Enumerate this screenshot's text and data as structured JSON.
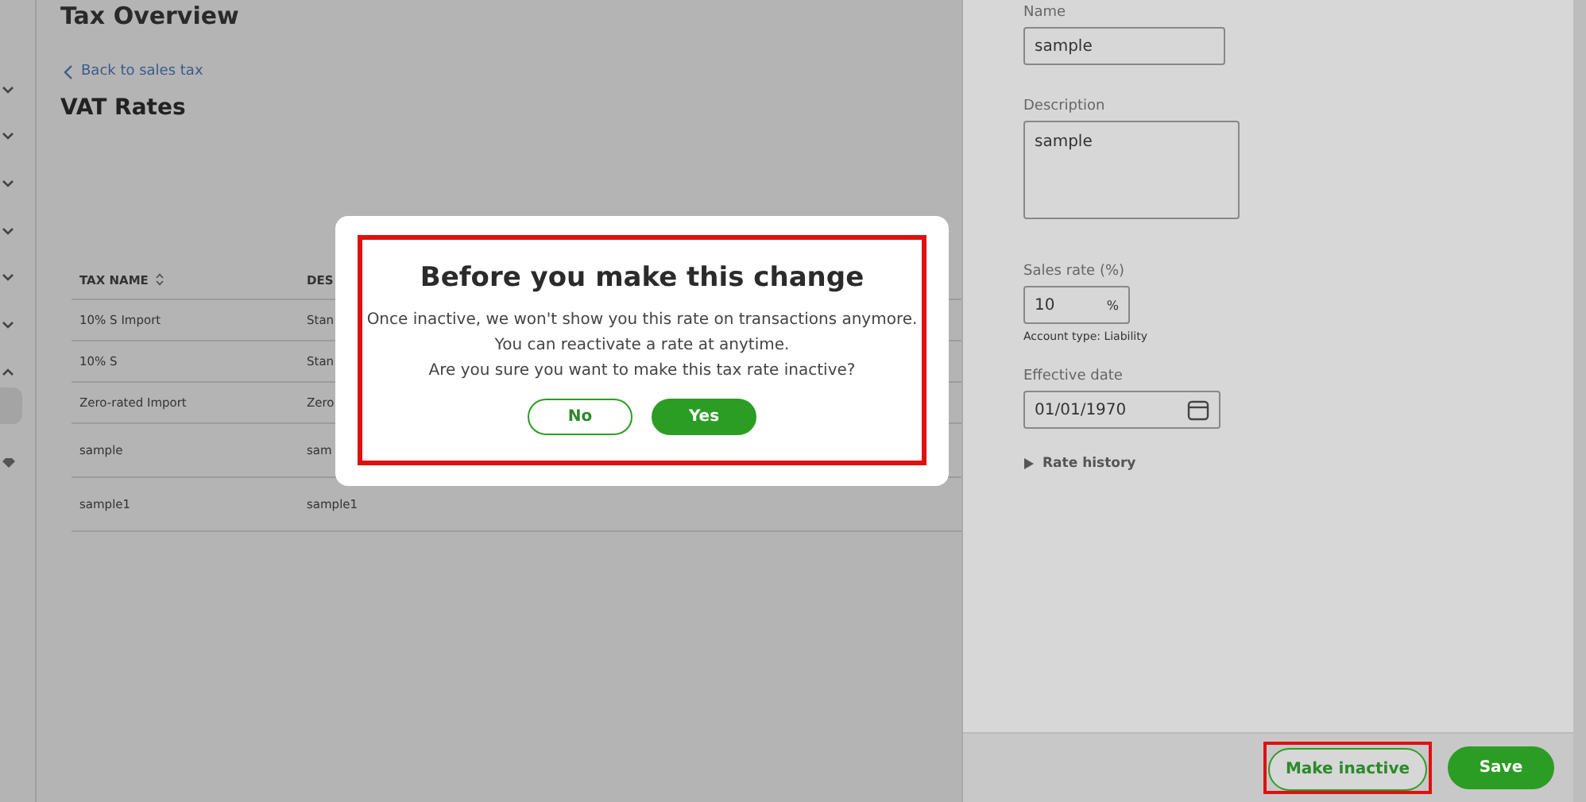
{
  "page": {
    "title": "Tax Overview",
    "back_link": "Back to sales tax",
    "heading": "VAT Rates"
  },
  "sidebar": {
    "items": [
      {
        "kind": "chevron",
        "expanded": false
      },
      {
        "kind": "chevron",
        "expanded": false
      },
      {
        "kind": "chevron",
        "expanded": false
      },
      {
        "kind": "chevron",
        "expanded": false
      },
      {
        "kind": "chevron",
        "expanded": false
      },
      {
        "kind": "chevron",
        "expanded": false
      },
      {
        "kind": "chevron",
        "expanded": true
      },
      {
        "kind": "active"
      },
      {
        "kind": "gem"
      }
    ]
  },
  "table": {
    "columns": [
      "TAX NAME",
      "DES"
    ],
    "rows": [
      [
        "10% S Import",
        "Stan"
      ],
      [
        "10% S",
        "Stan"
      ],
      [
        "Zero-rated Import",
        "Zero"
      ],
      [
        "sample",
        "sam"
      ],
      [
        "sample1",
        "sample1"
      ]
    ]
  },
  "dialog": {
    "title": "Before you make this change",
    "lines": [
      "Once inactive, we won't show you this rate on transactions anymore.",
      "You can reactivate a rate at anytime.",
      "Are you sure you want to make this tax rate inactive?"
    ],
    "highlighted": true,
    "buttons": [
      {
        "label": "No",
        "kind": "secondary"
      },
      {
        "label": "Yes",
        "kind": "primary"
      }
    ]
  },
  "panel": {
    "name": {
      "label": "Name",
      "value": "sample"
    },
    "description": {
      "label": "Description",
      "value": "sample"
    },
    "sales_rate": {
      "label": "Sales rate (%)",
      "value": "10",
      "suffix": "%"
    },
    "account_type": "Account type: Liability",
    "effective_date": {
      "label": "Effective date",
      "value": "01/01/1970"
    },
    "rate_history": "Rate history",
    "buttons": [
      {
        "label": "Make inactive",
        "kind": "secondary",
        "highlighted": true
      },
      {
        "label": "Save",
        "kind": "primary",
        "highlighted": false
      }
    ]
  }
}
